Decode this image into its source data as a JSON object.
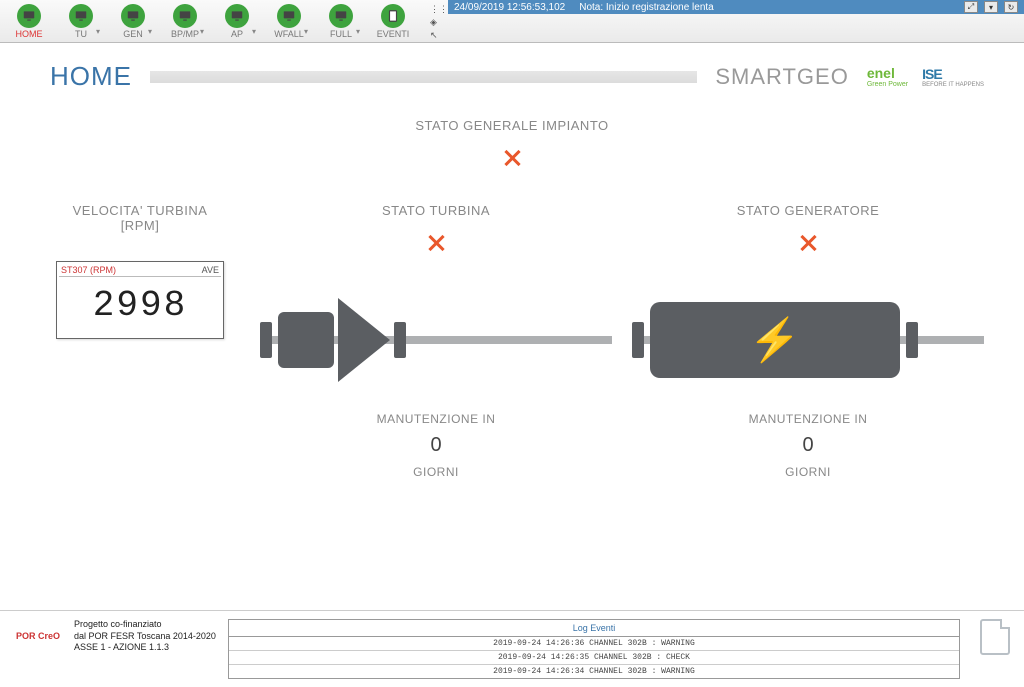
{
  "toolbar": {
    "items": [
      {
        "label": "HOME",
        "active": true
      },
      {
        "label": "TU"
      },
      {
        "label": "GEN"
      },
      {
        "label": "BP/MP"
      },
      {
        "label": "AP"
      },
      {
        "label": "WFALL"
      },
      {
        "label": "FULL"
      },
      {
        "label": "EVENTI"
      }
    ]
  },
  "statusbar": {
    "timestamp": "24/09/2019 12:56:53,102",
    "note": "Nota: Inizio registrazione lenta"
  },
  "header": {
    "page_title": "HOME",
    "brand": "SMARTGEO",
    "logo_enel": "enel",
    "logo_enel_sub": "Green Power",
    "logo_ise": "ISE",
    "logo_ise_sub": "BEFORE IT HAPPENS"
  },
  "plant": {
    "general_label": "STATO GENERALE IMPIANTO",
    "general_status": "X"
  },
  "turbine": {
    "speed_label": "VELOCITA' TURBINA",
    "speed_unit": "[RPM]",
    "gauge_channel": "ST307 (RPM)",
    "gauge_mode": "AVE",
    "gauge_value": "2998",
    "state_label": "STATO TURBINA",
    "state_status": "X",
    "maint_label": "MANUTENZIONE IN",
    "maint_days": "0",
    "maint_unit": "GIORNI"
  },
  "generator": {
    "state_label": "STATO GENERATORE",
    "state_status": "X",
    "maint_label": "MANUTENZIONE IN",
    "maint_days": "0",
    "maint_unit": "GIORNI"
  },
  "footer": {
    "por_logo": "POR CreO",
    "funding_line1": "Progetto co-finanziato",
    "funding_line2": "dal POR FESR Toscana 2014-2020",
    "funding_line3": "ASSE 1 - AZIONE 1.1.3",
    "log_title": "Log Eventi",
    "log_rows": [
      "2019-09-24 14:26:36 CHANNEL 302B : WARNING",
      "2019-09-24 14:26:35 CHANNEL 302B : CHECK",
      "2019-09-24 14:26:34 CHANNEL 302B : WARNING"
    ]
  }
}
